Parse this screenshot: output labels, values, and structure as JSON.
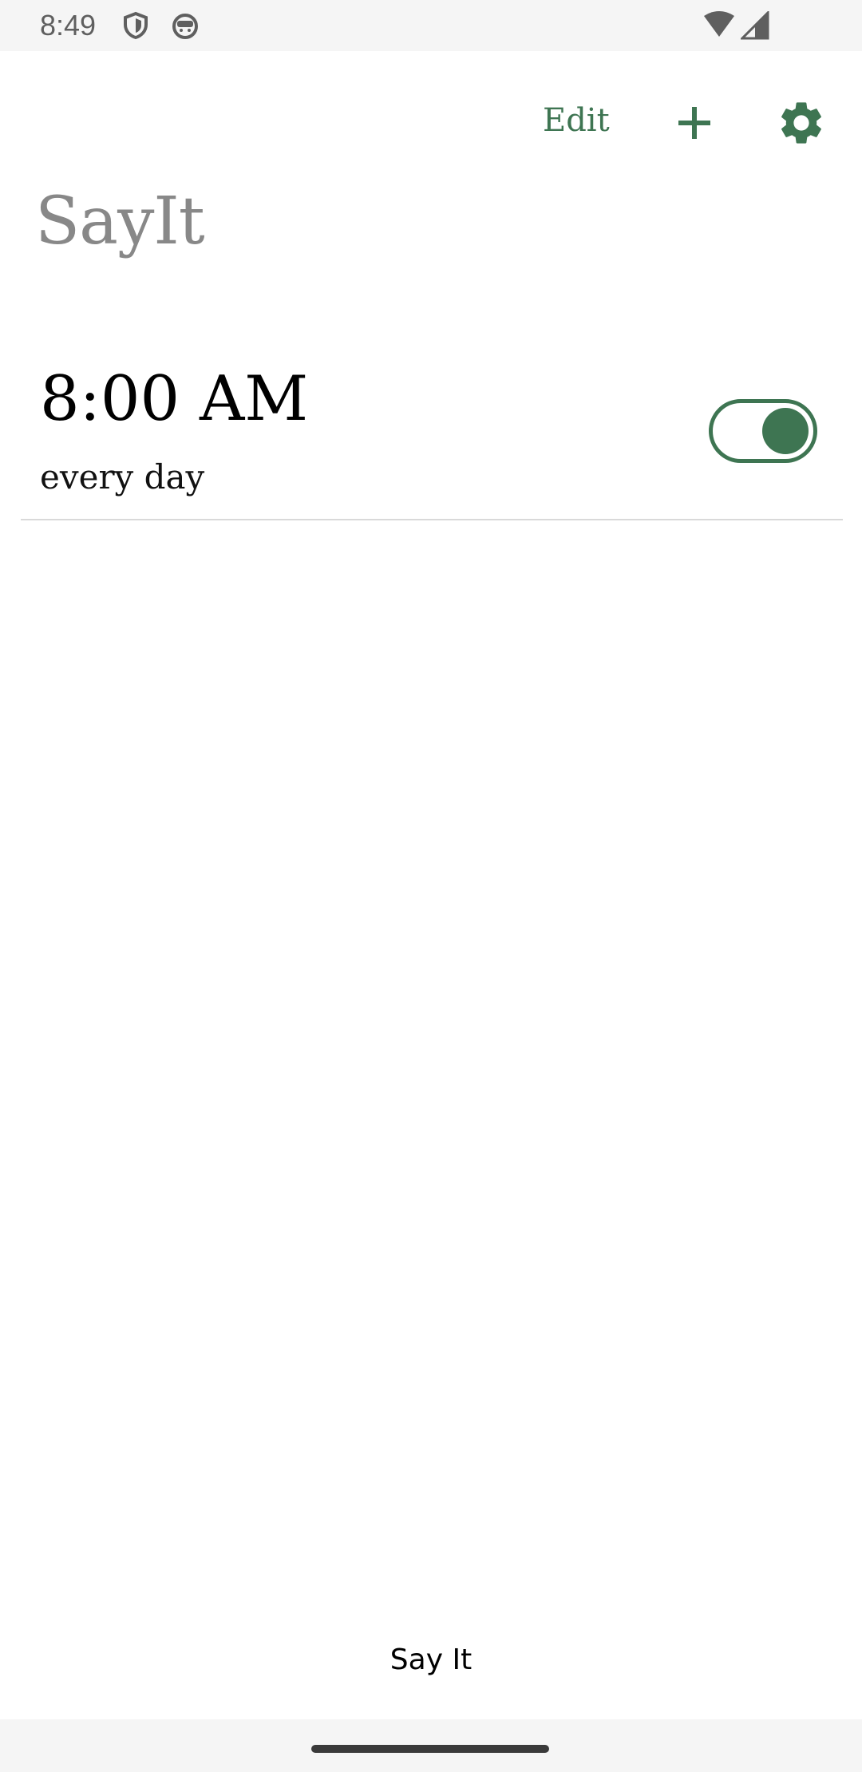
{
  "status_bar": {
    "time": "8:49",
    "icons": [
      "shield-icon",
      "face-icon",
      "wifi-icon",
      "cellular-signal-icon"
    ]
  },
  "header": {
    "edit_label": "Edit",
    "add_icon": "plus-icon",
    "settings_icon": "gear-icon"
  },
  "app": {
    "title": "SayIt"
  },
  "alarms": [
    {
      "time": "8:00 AM",
      "repeat": "every day",
      "enabled": true
    }
  ],
  "footer": {
    "action_label": "Say It"
  },
  "colors": {
    "accent": "#3e7552",
    "title_gray": "#888888",
    "divider": "#d9d9d9",
    "system_bar": "#f5f5f5"
  }
}
